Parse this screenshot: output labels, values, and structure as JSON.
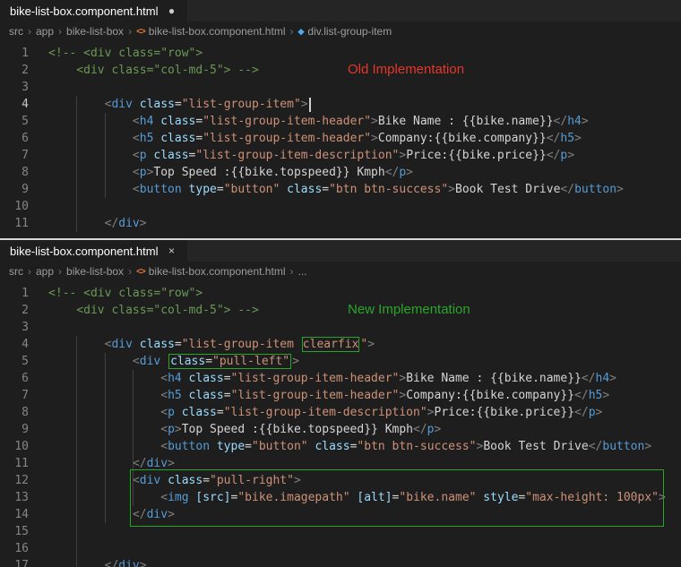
{
  "colors": {
    "highlight_green": "#2aa52a",
    "annotation_red": "#e5372a",
    "annotation_green": "#2aa52a"
  },
  "panels": [
    {
      "tab": {
        "title": "bike-list-box.component.html",
        "indicator": "●"
      },
      "breadcrumb": [
        {
          "label": "src"
        },
        {
          "label": "app"
        },
        {
          "label": "bike-list-box"
        },
        {
          "label": "bike-list-box.component.html",
          "icon": "code-icon"
        },
        {
          "label": "div.list-group-item",
          "icon": "symbol-icon"
        }
      ],
      "annotation": {
        "text": "Old Implementation",
        "color": "#e5372a"
      },
      "active_line": 4,
      "lines": [
        [
          [
            "c",
            "<!-- <div class=\"row\">"
          ]
        ],
        [
          [
            "c",
            "    <div class=\"col-md-5\"> -->"
          ]
        ],
        [],
        [
          [
            "p",
            "        <"
          ],
          [
            "t",
            "div"
          ],
          [
            "x",
            " "
          ],
          [
            "a",
            "class"
          ],
          [
            "x",
            "="
          ],
          [
            "s",
            "\"list-group-item\""
          ],
          [
            "p",
            ">"
          ],
          [
            "cur",
            ""
          ]
        ],
        [
          [
            "p",
            "            <"
          ],
          [
            "t",
            "h4"
          ],
          [
            "x",
            " "
          ],
          [
            "a",
            "class"
          ],
          [
            "x",
            "="
          ],
          [
            "s",
            "\"list-group-item-header\""
          ],
          [
            "p",
            ">"
          ],
          [
            "x",
            "Bike Name : {{bike.name}}"
          ],
          [
            "p",
            "</"
          ],
          [
            "t",
            "h4"
          ],
          [
            "p",
            ">"
          ]
        ],
        [
          [
            "p",
            "            <"
          ],
          [
            "t",
            "h5"
          ],
          [
            "x",
            " "
          ],
          [
            "a",
            "class"
          ],
          [
            "x",
            "="
          ],
          [
            "s",
            "\"list-group-item-header\""
          ],
          [
            "p",
            ">"
          ],
          [
            "x",
            "Company:{{bike.company}}"
          ],
          [
            "p",
            "</"
          ],
          [
            "t",
            "h5"
          ],
          [
            "p",
            ">"
          ]
        ],
        [
          [
            "p",
            "            <"
          ],
          [
            "t",
            "p"
          ],
          [
            "x",
            " "
          ],
          [
            "a",
            "class"
          ],
          [
            "x",
            "="
          ],
          [
            "s",
            "\"list-group-item-description\""
          ],
          [
            "p",
            ">"
          ],
          [
            "x",
            "Price:{{bike.price}}"
          ],
          [
            "p",
            "</"
          ],
          [
            "t",
            "p"
          ],
          [
            "p",
            ">"
          ]
        ],
        [
          [
            "p",
            "            <"
          ],
          [
            "t",
            "p"
          ],
          [
            "p",
            ">"
          ],
          [
            "x",
            "Top Speed :{{bike.topspeed}} Kmph"
          ],
          [
            "p",
            "</"
          ],
          [
            "t",
            "p"
          ],
          [
            "p",
            ">"
          ]
        ],
        [
          [
            "p",
            "            <"
          ],
          [
            "t",
            "button"
          ],
          [
            "x",
            " "
          ],
          [
            "a",
            "type"
          ],
          [
            "x",
            "="
          ],
          [
            "s",
            "\"button\""
          ],
          [
            "x",
            " "
          ],
          [
            "a",
            "class"
          ],
          [
            "x",
            "="
          ],
          [
            "s",
            "\"btn btn-success\""
          ],
          [
            "p",
            ">"
          ],
          [
            "x",
            "Book Test Drive"
          ],
          [
            "p",
            "</"
          ],
          [
            "t",
            "button"
          ],
          [
            "p",
            ">"
          ]
        ],
        [],
        [
          [
            "p",
            "        </"
          ],
          [
            "t",
            "div"
          ],
          [
            "p",
            ">"
          ]
        ]
      ]
    },
    {
      "tab": {
        "title": "bike-list-box.component.html",
        "indicator": "×"
      },
      "breadcrumb": [
        {
          "label": "src"
        },
        {
          "label": "app"
        },
        {
          "label": "bike-list-box"
        },
        {
          "label": "bike-list-box.component.html",
          "icon": "code-icon"
        },
        {
          "label": "..."
        }
      ],
      "annotation": {
        "text": "New Implementation",
        "color": "#2aa52a"
      },
      "active_line": null,
      "lines": [
        [
          [
            "c",
            "<!-- <div class=\"row\">"
          ]
        ],
        [
          [
            "c",
            "    <div class=\"col-md-5\"> -->"
          ]
        ],
        [],
        [
          [
            "p",
            "        <"
          ],
          [
            "t",
            "div"
          ],
          [
            "x",
            " "
          ],
          [
            "a",
            "class"
          ],
          [
            "x",
            "="
          ],
          [
            "s",
            "\"list-group-item "
          ],
          [
            "sb",
            "clearfix"
          ],
          [
            "s",
            "\""
          ],
          [
            "p",
            ">"
          ]
        ],
        [
          [
            "p",
            "            <"
          ],
          [
            "t",
            "div"
          ],
          [
            "x",
            " "
          ],
          [
            "box",
            [
              [
                "a",
                "class"
              ],
              [
                "x",
                "="
              ],
              [
                "s",
                "\"pull-left\""
              ]
            ]
          ],
          [
            "p",
            ">"
          ]
        ],
        [
          [
            "p",
            "                <"
          ],
          [
            "t",
            "h4"
          ],
          [
            "x",
            " "
          ],
          [
            "a",
            "class"
          ],
          [
            "x",
            "="
          ],
          [
            "s",
            "\"list-group-item-header\""
          ],
          [
            "p",
            ">"
          ],
          [
            "x",
            "Bike Name : {{bike.name}}"
          ],
          [
            "p",
            "</"
          ],
          [
            "t",
            "h4"
          ],
          [
            "p",
            ">"
          ]
        ],
        [
          [
            "p",
            "                <"
          ],
          [
            "t",
            "h5"
          ],
          [
            "x",
            " "
          ],
          [
            "a",
            "class"
          ],
          [
            "x",
            "="
          ],
          [
            "s",
            "\"list-group-item-header\""
          ],
          [
            "p",
            ">"
          ],
          [
            "x",
            "Company:{{bike.company}}"
          ],
          [
            "p",
            "</"
          ],
          [
            "t",
            "h5"
          ],
          [
            "p",
            ">"
          ]
        ],
        [
          [
            "p",
            "                <"
          ],
          [
            "t",
            "p"
          ],
          [
            "x",
            " "
          ],
          [
            "a",
            "class"
          ],
          [
            "x",
            "="
          ],
          [
            "s",
            "\"list-group-item-description\""
          ],
          [
            "p",
            ">"
          ],
          [
            "x",
            "Price:{{bike.price}}"
          ],
          [
            "p",
            "</"
          ],
          [
            "t",
            "p"
          ],
          [
            "p",
            ">"
          ]
        ],
        [
          [
            "p",
            "                <"
          ],
          [
            "t",
            "p"
          ],
          [
            "p",
            ">"
          ],
          [
            "x",
            "Top Speed :{{bike.topspeed}} Kmph"
          ],
          [
            "p",
            "</"
          ],
          [
            "t",
            "p"
          ],
          [
            "p",
            ">"
          ]
        ],
        [
          [
            "p",
            "                <"
          ],
          [
            "t",
            "button"
          ],
          [
            "x",
            " "
          ],
          [
            "a",
            "type"
          ],
          [
            "x",
            "="
          ],
          [
            "s",
            "\"button\""
          ],
          [
            "x",
            " "
          ],
          [
            "a",
            "class"
          ],
          [
            "x",
            "="
          ],
          [
            "s",
            "\"btn btn-success\""
          ],
          [
            "p",
            ">"
          ],
          [
            "x",
            "Book Test Drive"
          ],
          [
            "p",
            "</"
          ],
          [
            "t",
            "button"
          ],
          [
            "p",
            ">"
          ]
        ],
        [
          [
            "p",
            "            </"
          ],
          [
            "t",
            "div"
          ],
          [
            "p",
            ">"
          ]
        ],
        [
          [
            "p",
            "            <"
          ],
          [
            "t",
            "div"
          ],
          [
            "x",
            " "
          ],
          [
            "a",
            "class"
          ],
          [
            "x",
            "="
          ],
          [
            "s",
            "\"pull-right\""
          ],
          [
            "p",
            ">"
          ]
        ],
        [
          [
            "p",
            "                <"
          ],
          [
            "t",
            "img"
          ],
          [
            "x",
            " "
          ],
          [
            "a",
            "[src]"
          ],
          [
            "x",
            "="
          ],
          [
            "s",
            "\"bike.imagepath\""
          ],
          [
            "x",
            " "
          ],
          [
            "a",
            "[alt]"
          ],
          [
            "x",
            "="
          ],
          [
            "s",
            "\"bike.name\""
          ],
          [
            "x",
            " "
          ],
          [
            "a",
            "style"
          ],
          [
            "x",
            "="
          ],
          [
            "s",
            "\"max-height: 100px\""
          ],
          [
            "p",
            ">"
          ]
        ],
        [
          [
            "p",
            "            </"
          ],
          [
            "t",
            "div"
          ],
          [
            "p",
            ">"
          ]
        ],
        [],
        [],
        [
          [
            "p",
            "        </"
          ],
          [
            "t",
            "div"
          ],
          [
            "p",
            ">"
          ]
        ]
      ]
    }
  ]
}
